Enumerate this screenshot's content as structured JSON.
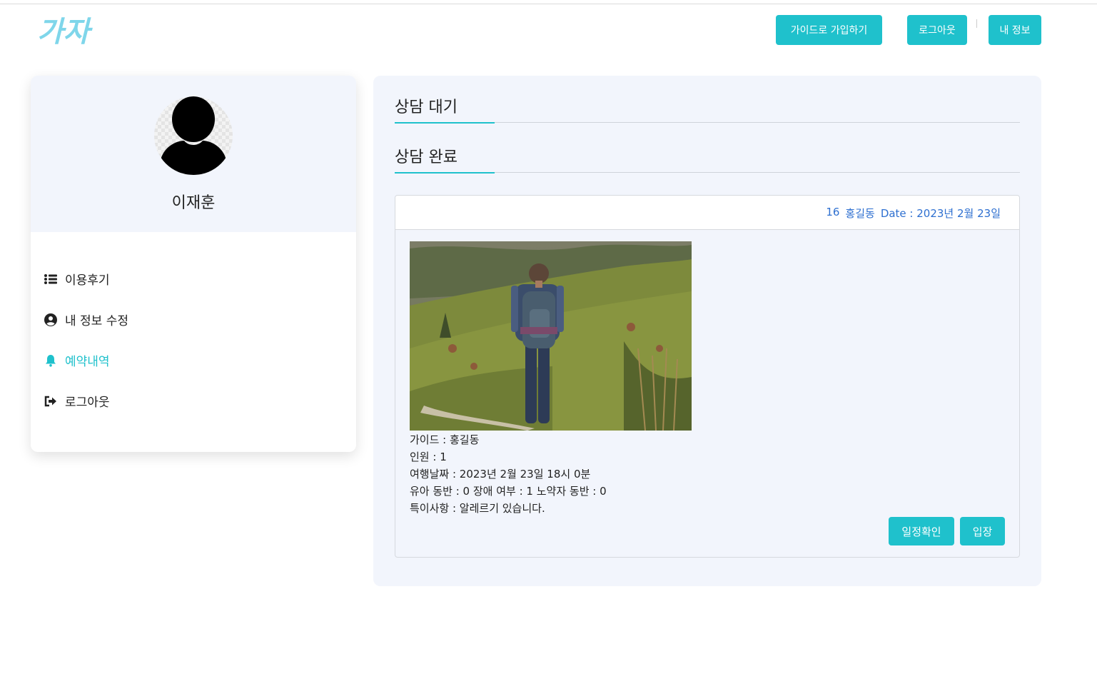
{
  "app": {
    "logo_text": "가자"
  },
  "header": {
    "join_guide_label": "가이드로 가입하기",
    "logout_label": "로그아웃",
    "my_info_label": "내 정보"
  },
  "profile": {
    "name": "이재훈"
  },
  "sidebar": {
    "items": [
      {
        "label": "이용후기",
        "icon": "list-icon"
      },
      {
        "label": "내 정보 수정",
        "icon": "user-circle-icon"
      },
      {
        "label": "예약내역",
        "icon": "bell-icon",
        "active": true
      },
      {
        "label": "로그아웃",
        "icon": "sign-out-icon"
      }
    ]
  },
  "tabs": {
    "pending_label": "상담 대기",
    "done_label": "상담 완료"
  },
  "booking": {
    "id": "16",
    "guide_name": "홍길동",
    "date_label": "Date : 2023년 2월 23일",
    "guide_line": "가이드 : 홍길동",
    "people_line": "인원 : 1",
    "travel_date_line": "여행날짜 : 2023년 2월 23일 18시 0분",
    "companions_line": "유아 동반 : 0 장애 여부 : 1 노약자 동반 : 0",
    "notes_line": "특이사항 : 알레르기 있습니다.",
    "schedule_button": "일정확인",
    "enter_button": "입장"
  },
  "colors": {
    "accent": "#1fc1cc",
    "panel_bg": "#f2f5fc",
    "link_blue": "#2d6fd0"
  }
}
